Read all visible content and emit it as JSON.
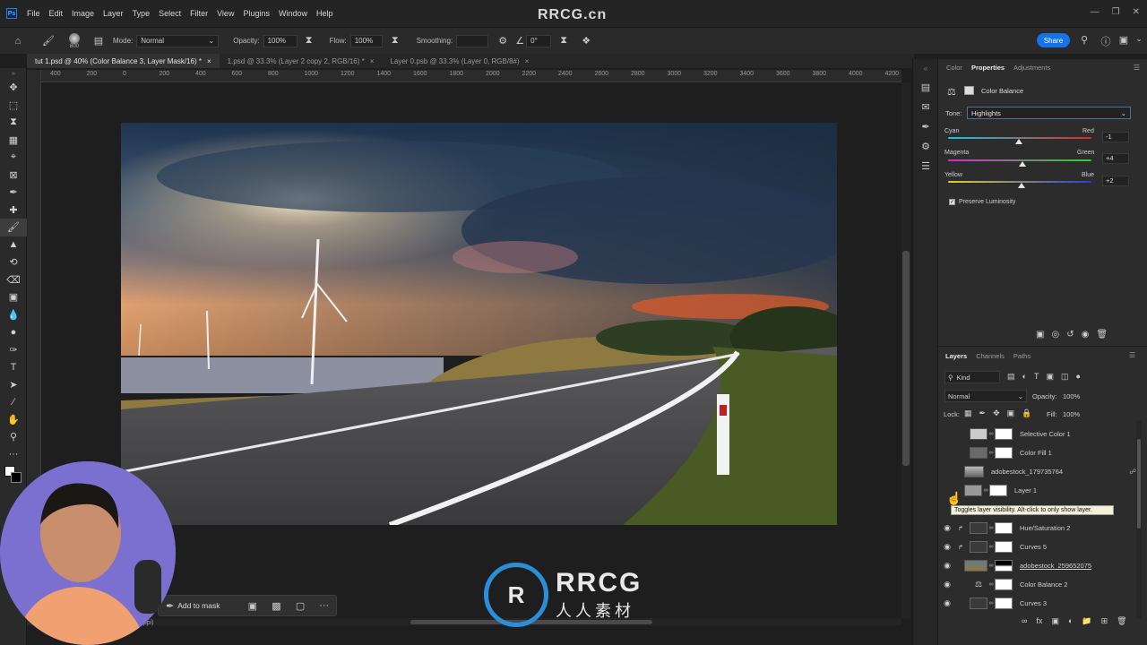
{
  "app": {
    "logo_text": "Ps",
    "menus": [
      "File",
      "Edit",
      "Image",
      "Layer",
      "Type",
      "Select",
      "Filter",
      "View",
      "Plugins",
      "Window",
      "Help"
    ],
    "watermark_top": "RRCG.cn",
    "watermark_main": "RRCG",
    "watermark_sub": "人人素材"
  },
  "options": {
    "brush_size": "800",
    "mode_label": "Mode:",
    "mode_value": "Normal",
    "opacity_label": "Opacity:",
    "opacity_value": "100%",
    "flow_label": "Flow:",
    "flow_value": "100%",
    "smoothing_label": "Smoothing:",
    "smoothing_value": "",
    "angle_value": "0°",
    "share_label": "Share"
  },
  "tabs": [
    {
      "label": "tut 1.psd @ 40% (Color Balance 3, Layer Mask/16) *",
      "close": "×"
    },
    {
      "label": "1.psd @ 33.3% (Layer 2 copy 2, RGB/16) *",
      "close": "×"
    },
    {
      "label": "Layer 0.psb @ 33.3% (Layer 0, RGB/8#)",
      "close": "×"
    }
  ],
  "ruler": [
    "400",
    "200",
    "0",
    "200",
    "400",
    "600",
    "800",
    "1000",
    "1200",
    "1400",
    "1600",
    "1800",
    "2000",
    "2200",
    "2400",
    "2600",
    "2800",
    "3000",
    "3200",
    "3400",
    "3600",
    "3800",
    "4000",
    "4200"
  ],
  "properties": {
    "tabs": [
      "Color",
      "Properties",
      "Adjustments"
    ],
    "adjustment_name": "Color Balance",
    "tone_label": "Tone:",
    "tone_value": "Highlights",
    "sliders": [
      {
        "left": "Cyan",
        "right": "Red",
        "value": "-1",
        "level": -1
      },
      {
        "left": "Magenta",
        "right": "Green",
        "value": "+4",
        "level": 4
      },
      {
        "left": "Yellow",
        "right": "Blue",
        "value": "+2",
        "level": 2
      }
    ],
    "preserve_label": "Preserve Luminosity"
  },
  "layers_panel": {
    "tabs": [
      "Layers",
      "Channels",
      "Paths"
    ],
    "filter_value": "Kind",
    "blend_value": "Normal",
    "opacity_label": "Opacity:",
    "opacity_value": "100%",
    "lock_label": "Lock:",
    "fill_label": "Fill:",
    "fill_value": "100%",
    "layers": [
      {
        "name": "Selective Color 1",
        "visible": false
      },
      {
        "name": "Color Fill 1",
        "visible": false
      },
      {
        "name": "adobestock_179735764",
        "visible": false
      },
      {
        "name": "Layer 1",
        "visible": false
      },
      {
        "name": "Hue/Saturation 2",
        "visible": true
      },
      {
        "name": "Curves 5",
        "visible": true
      },
      {
        "name": "adobestock_259652075",
        "visible": true
      },
      {
        "name": "Color Balance 2",
        "visible": true
      },
      {
        "name": "Curves 3",
        "visible": true
      }
    ],
    "tooltip": "Toggles layer visibility. Alt-click to only show layer."
  },
  "contextual_bar": {
    "add_to_mask": "Add to mask",
    "more": "···"
  },
  "status": {
    "doc_info": "00 ppi)"
  }
}
